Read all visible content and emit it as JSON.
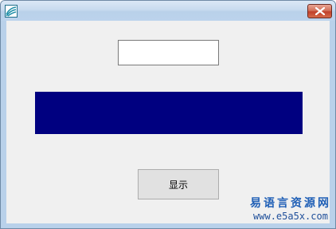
{
  "window": {
    "icon": "app-logo-icon",
    "close_icon": "close-icon"
  },
  "form": {
    "input_value": "",
    "label_text": "",
    "label_color": "#000080",
    "button_label": "显示"
  },
  "watermark": {
    "title": "易语言资源网",
    "url": "www.e5a5x.com"
  }
}
